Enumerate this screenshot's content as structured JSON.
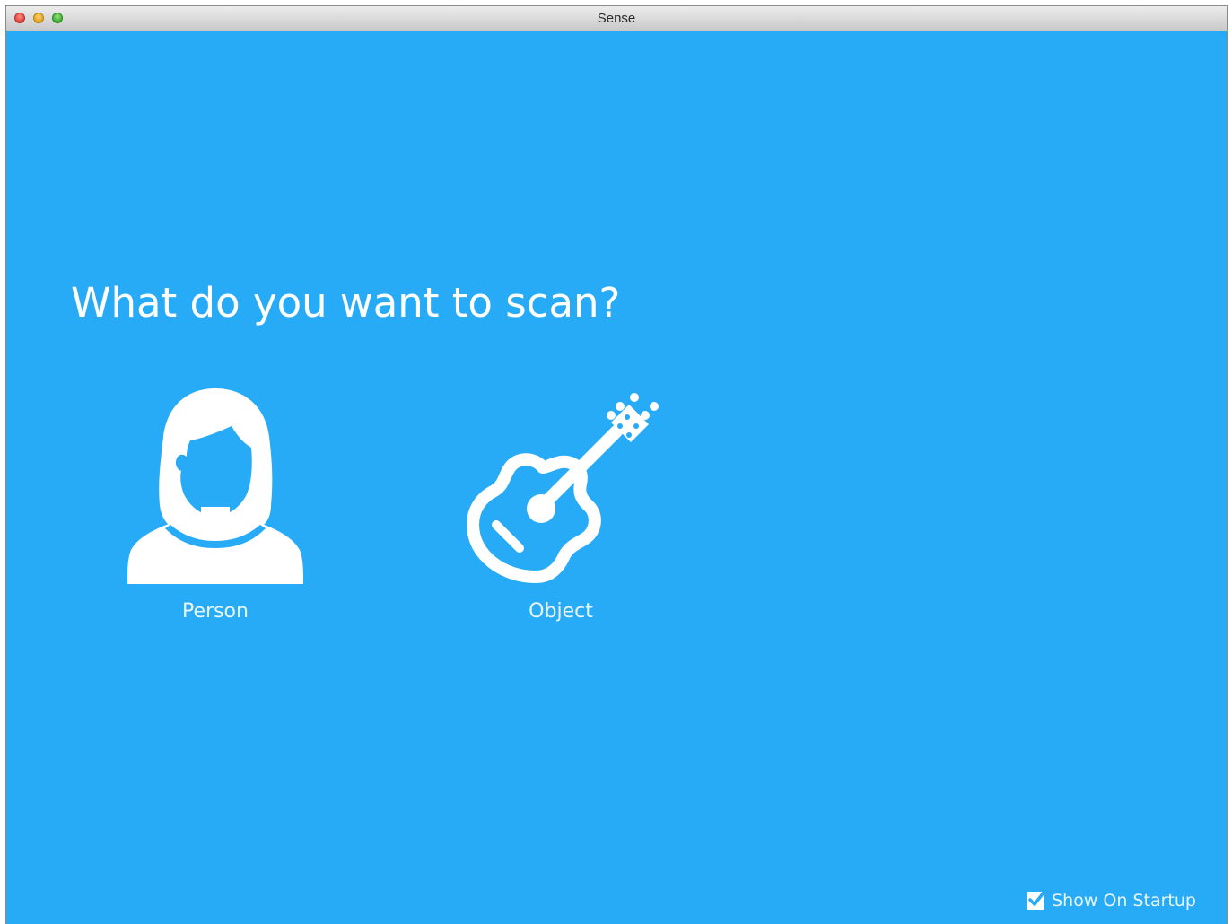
{
  "window": {
    "title": "Sense",
    "background_color": "#28abf6"
  },
  "main": {
    "heading": "What do you want to scan?",
    "options": [
      {
        "label": "Person",
        "icon": "person-icon"
      },
      {
        "label": "Object",
        "icon": "guitar-icon"
      }
    ]
  },
  "footer": {
    "show_on_startup_label": "Show On Startup",
    "show_on_startup_checked": true
  }
}
